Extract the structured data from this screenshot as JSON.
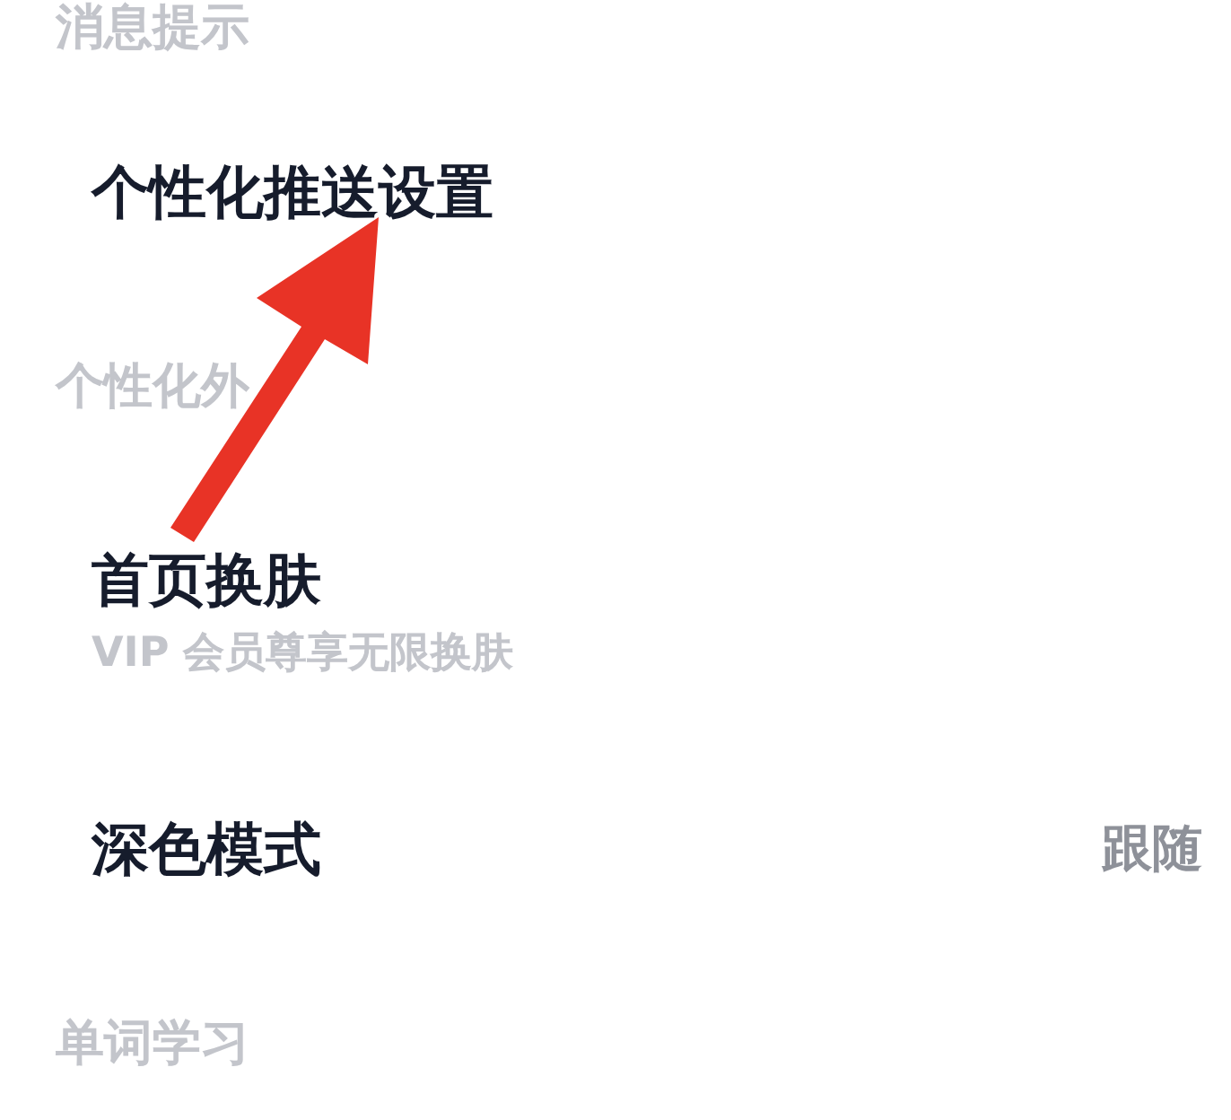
{
  "sections": [
    {
      "header": "消息提示",
      "items": [
        {
          "title": "个性化推送设置"
        }
      ]
    },
    {
      "header": "个性化外",
      "items": [
        {
          "title": "首页换肤",
          "subtitle": "VIP 会员尊享无限换肤"
        },
        {
          "title": "深色模式",
          "value": "跟随"
        }
      ]
    },
    {
      "header": "单词学习"
    }
  ]
}
